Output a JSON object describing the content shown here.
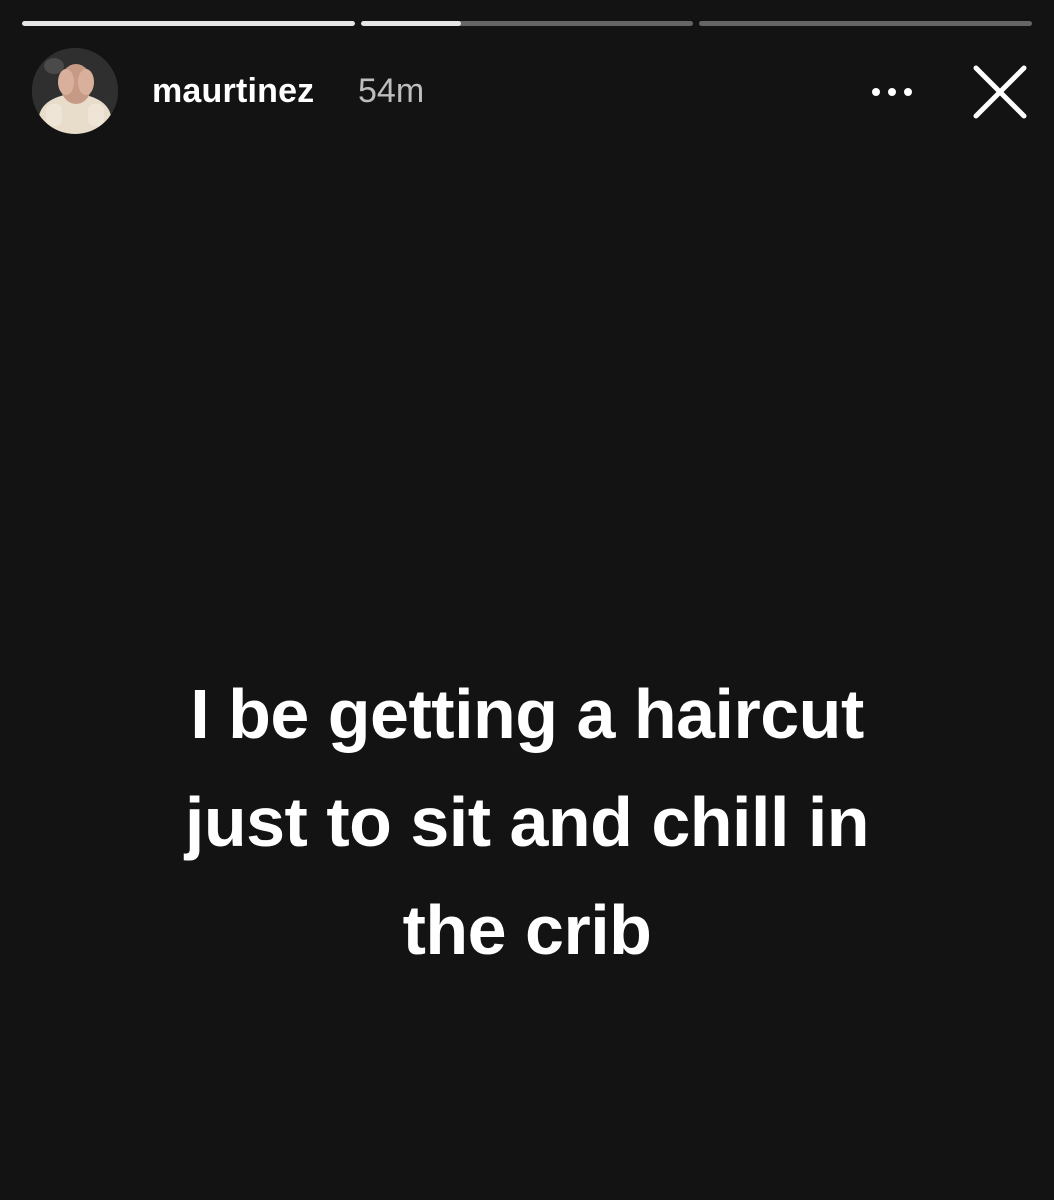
{
  "progress": {
    "segments": [
      {
        "fill": 1.0
      },
      {
        "fill": 0.3
      },
      {
        "fill": 0.0
      }
    ]
  },
  "header": {
    "username": "maurtinez",
    "timestamp": "54m"
  },
  "icons": {
    "avatar": "profile-photo",
    "more": "more-horizontal-icon",
    "close": "close-icon"
  },
  "story": {
    "lines": [
      "I be getting a haircut",
      "just to sit and chill in",
      "the crib"
    ]
  },
  "colors": {
    "background": "#131313",
    "text": "#ffffff",
    "muted_text": "#bdbdbd"
  }
}
